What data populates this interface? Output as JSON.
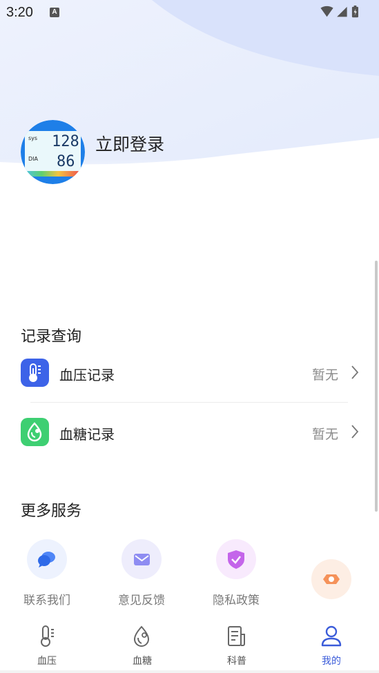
{
  "status_bar": {
    "time": "3:20",
    "notification_icon": "a-notification-icon",
    "icons": [
      "wifi-icon",
      "cell-signal-icon",
      "battery-icon"
    ]
  },
  "profile": {
    "login_label": "立即登录",
    "avatar_icon": "blood-pressure-monitor-icon",
    "avatar_readout": {
      "sys_label": "sys",
      "sys_value": "128",
      "dia_label": "DIA",
      "dia_value": "86"
    }
  },
  "records": {
    "title": "记录查询",
    "items": [
      {
        "label": "血压记录",
        "value": "暂无",
        "icon": "thermometer-icon",
        "color": "#3d63e8"
      },
      {
        "label": "血糖记录",
        "value": "暂无",
        "icon": "blood-drop-icon",
        "color": "#3ecf72"
      }
    ]
  },
  "services": {
    "title": "更多服务",
    "items": [
      {
        "label": "联系我们",
        "icon": "chat-bubble-icon",
        "color": "#4f86f7"
      },
      {
        "label": "意见反馈",
        "icon": "envelope-icon",
        "color": "#8e8cf2"
      },
      {
        "label": "隐私政策",
        "icon": "shield-check-icon",
        "color": "#c465ea"
      },
      {
        "label": "",
        "icon": "hexagon-settings-icon",
        "color": "#f5925a"
      }
    ]
  },
  "tabbar": {
    "items": [
      {
        "label": "血压",
        "icon": "thermometer-tab-icon",
        "active": false
      },
      {
        "label": "血糖",
        "icon": "drop-tab-icon",
        "active": false
      },
      {
        "label": "科普",
        "icon": "article-tab-icon",
        "active": false
      },
      {
        "label": "我的",
        "icon": "person-tab-icon",
        "active": true
      }
    ],
    "active_color": "#3a5bd9"
  }
}
